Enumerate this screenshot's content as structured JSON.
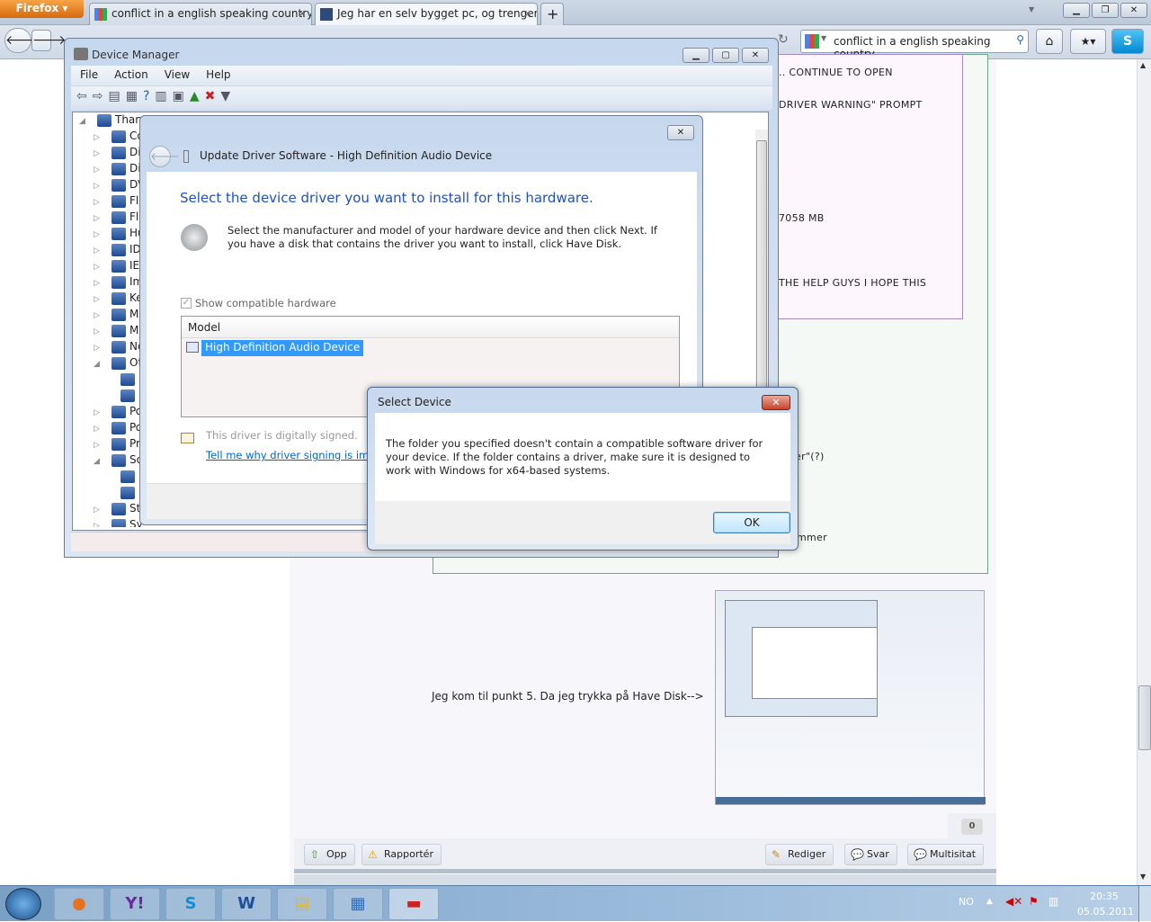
{
  "browser": {
    "menu_button": "Firefox",
    "tabs": [
      {
        "title": "conflict in a english speaking country...",
        "active": false
      },
      {
        "title": "Jeg har en selv bygget pc, og trenger ...",
        "active": true
      }
    ],
    "new_tab": "+",
    "search_value": "conflict in a english speaking country"
  },
  "page": {
    "post_lines": [
      ".. CONTINUE TO OPEN",
      "DRIVER WARNING\" PROMPT",
      "7058 MB",
      "THE HELP GUYS I HOPE THIS"
    ],
    "post_fragments": [
      "er\"(?)",
      "mmer"
    ],
    "body_text": "Jeg kom til punkt 5. Da jeg trykka på Have Disk-->",
    "count_badge": "0",
    "buttons": {
      "up": "Opp",
      "report": "Rapportér",
      "edit": "Rediger",
      "reply": "Svar",
      "multiquote": "Multisitat"
    }
  },
  "device_manager": {
    "title": "Device Manager",
    "menu": [
      "File",
      "Action",
      "View",
      "Help"
    ],
    "tree": [
      "Thank",
      "Co",
      "Di",
      "Di",
      "DV",
      "Fl",
      "Fl",
      "Hu",
      "ID",
      "IEI",
      "Im",
      "Ke",
      "M",
      "M",
      "Ne",
      "Ot",
      "",
      "",
      "Po",
      "Po",
      "Pr",
      "So",
      "",
      "",
      "St",
      "Sys"
    ]
  },
  "update_driver": {
    "title": "Update Driver Software - High Definition Audio Device",
    "heading": "Select the device driver you want to install for this hardware.",
    "description": "Select the manufacturer and model of your hardware device and then click Next. If you have a disk that contains the driver you want to install, click Have Disk.",
    "checkbox_label": "Show compatible hardware",
    "checkbox_checked": true,
    "column_header": "Model",
    "models": [
      "High Definition Audio Device"
    ],
    "signed_text": "This driver is digitally signed.",
    "signing_link": "Tell me why driver signing is important"
  },
  "select_device": {
    "title": "Select Device",
    "message": "The folder you specified doesn't contain a compatible software driver for your device. If the folder contains a driver, make sure it is designed to work with Windows for x64-based systems.",
    "ok": "OK"
  },
  "taskbar": {
    "language": "NO",
    "time": "20:35",
    "date": "05.05.2011"
  }
}
